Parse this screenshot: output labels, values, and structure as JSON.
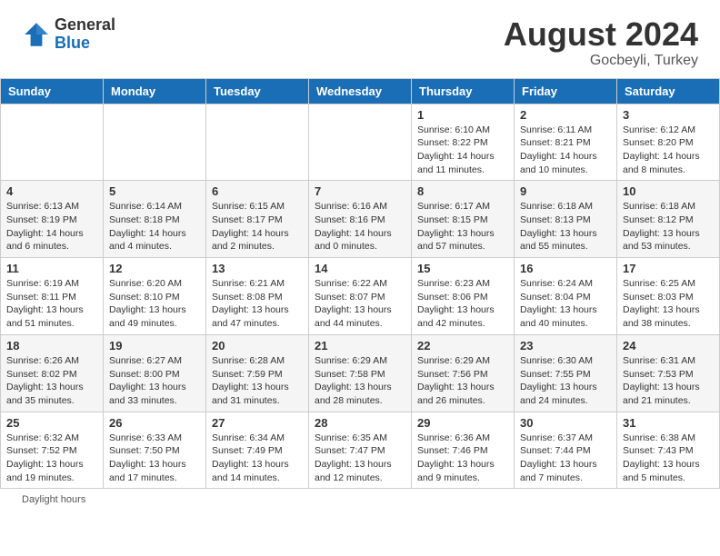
{
  "header": {
    "logo_general": "General",
    "logo_blue": "Blue",
    "month_title": "August 2024",
    "location": "Gocbeyli, Turkey"
  },
  "calendar": {
    "days_of_week": [
      "Sunday",
      "Monday",
      "Tuesday",
      "Wednesday",
      "Thursday",
      "Friday",
      "Saturday"
    ],
    "weeks": [
      [
        {
          "day": "",
          "info": ""
        },
        {
          "day": "",
          "info": ""
        },
        {
          "day": "",
          "info": ""
        },
        {
          "day": "",
          "info": ""
        },
        {
          "day": "1",
          "info": "Sunrise: 6:10 AM\nSunset: 8:22 PM\nDaylight: 14 hours\nand 11 minutes."
        },
        {
          "day": "2",
          "info": "Sunrise: 6:11 AM\nSunset: 8:21 PM\nDaylight: 14 hours\nand 10 minutes."
        },
        {
          "day": "3",
          "info": "Sunrise: 6:12 AM\nSunset: 8:20 PM\nDaylight: 14 hours\nand 8 minutes."
        }
      ],
      [
        {
          "day": "4",
          "info": "Sunrise: 6:13 AM\nSunset: 8:19 PM\nDaylight: 14 hours\nand 6 minutes."
        },
        {
          "day": "5",
          "info": "Sunrise: 6:14 AM\nSunset: 8:18 PM\nDaylight: 14 hours\nand 4 minutes."
        },
        {
          "day": "6",
          "info": "Sunrise: 6:15 AM\nSunset: 8:17 PM\nDaylight: 14 hours\nand 2 minutes."
        },
        {
          "day": "7",
          "info": "Sunrise: 6:16 AM\nSunset: 8:16 PM\nDaylight: 14 hours\nand 0 minutes."
        },
        {
          "day": "8",
          "info": "Sunrise: 6:17 AM\nSunset: 8:15 PM\nDaylight: 13 hours\nand 57 minutes."
        },
        {
          "day": "9",
          "info": "Sunrise: 6:18 AM\nSunset: 8:13 PM\nDaylight: 13 hours\nand 55 minutes."
        },
        {
          "day": "10",
          "info": "Sunrise: 6:18 AM\nSunset: 8:12 PM\nDaylight: 13 hours\nand 53 minutes."
        }
      ],
      [
        {
          "day": "11",
          "info": "Sunrise: 6:19 AM\nSunset: 8:11 PM\nDaylight: 13 hours\nand 51 minutes."
        },
        {
          "day": "12",
          "info": "Sunrise: 6:20 AM\nSunset: 8:10 PM\nDaylight: 13 hours\nand 49 minutes."
        },
        {
          "day": "13",
          "info": "Sunrise: 6:21 AM\nSunset: 8:08 PM\nDaylight: 13 hours\nand 47 minutes."
        },
        {
          "day": "14",
          "info": "Sunrise: 6:22 AM\nSunset: 8:07 PM\nDaylight: 13 hours\nand 44 minutes."
        },
        {
          "day": "15",
          "info": "Sunrise: 6:23 AM\nSunset: 8:06 PM\nDaylight: 13 hours\nand 42 minutes."
        },
        {
          "day": "16",
          "info": "Sunrise: 6:24 AM\nSunset: 8:04 PM\nDaylight: 13 hours\nand 40 minutes."
        },
        {
          "day": "17",
          "info": "Sunrise: 6:25 AM\nSunset: 8:03 PM\nDaylight: 13 hours\nand 38 minutes."
        }
      ],
      [
        {
          "day": "18",
          "info": "Sunrise: 6:26 AM\nSunset: 8:02 PM\nDaylight: 13 hours\nand 35 minutes."
        },
        {
          "day": "19",
          "info": "Sunrise: 6:27 AM\nSunset: 8:00 PM\nDaylight: 13 hours\nand 33 minutes."
        },
        {
          "day": "20",
          "info": "Sunrise: 6:28 AM\nSunset: 7:59 PM\nDaylight: 13 hours\nand 31 minutes."
        },
        {
          "day": "21",
          "info": "Sunrise: 6:29 AM\nSunset: 7:58 PM\nDaylight: 13 hours\nand 28 minutes."
        },
        {
          "day": "22",
          "info": "Sunrise: 6:29 AM\nSunset: 7:56 PM\nDaylight: 13 hours\nand 26 minutes."
        },
        {
          "day": "23",
          "info": "Sunrise: 6:30 AM\nSunset: 7:55 PM\nDaylight: 13 hours\nand 24 minutes."
        },
        {
          "day": "24",
          "info": "Sunrise: 6:31 AM\nSunset: 7:53 PM\nDaylight: 13 hours\nand 21 minutes."
        }
      ],
      [
        {
          "day": "25",
          "info": "Sunrise: 6:32 AM\nSunset: 7:52 PM\nDaylight: 13 hours\nand 19 minutes."
        },
        {
          "day": "26",
          "info": "Sunrise: 6:33 AM\nSunset: 7:50 PM\nDaylight: 13 hours\nand 17 minutes."
        },
        {
          "day": "27",
          "info": "Sunrise: 6:34 AM\nSunset: 7:49 PM\nDaylight: 13 hours\nand 14 minutes."
        },
        {
          "day": "28",
          "info": "Sunrise: 6:35 AM\nSunset: 7:47 PM\nDaylight: 13 hours\nand 12 minutes."
        },
        {
          "day": "29",
          "info": "Sunrise: 6:36 AM\nSunset: 7:46 PM\nDaylight: 13 hours\nand 9 minutes."
        },
        {
          "day": "30",
          "info": "Sunrise: 6:37 AM\nSunset: 7:44 PM\nDaylight: 13 hours\nand 7 minutes."
        },
        {
          "day": "31",
          "info": "Sunrise: 6:38 AM\nSunset: 7:43 PM\nDaylight: 13 hours\nand 5 minutes."
        }
      ]
    ]
  },
  "footer": {
    "text": "Daylight hours"
  }
}
